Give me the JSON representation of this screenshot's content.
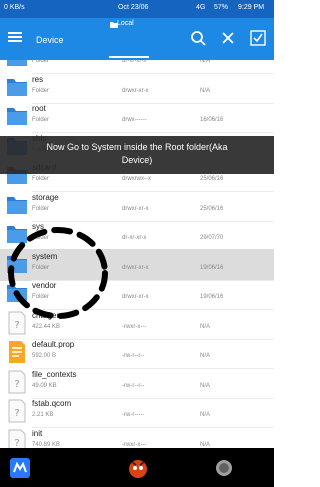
{
  "status_bar": {
    "time": "9:29 PM",
    "date": "Oct 23/06",
    "speed": "0 KB/s",
    "network": "4G",
    "battery": "57%"
  },
  "toolbar": {
    "title": "Device",
    "tab_label": "Local",
    "icons": [
      "menu-icon",
      "search-icon",
      "close-icon",
      "select-all-icon"
    ]
  },
  "files": [
    {
      "name": "proc",
      "type": "Folder",
      "perm": "dr-xr-xr-x",
      "date": "N/A",
      "icon": "folder"
    },
    {
      "name": "res",
      "type": "Folder",
      "perm": "drwxr-xr-x",
      "date": "N/A",
      "icon": "folder"
    },
    {
      "name": "root",
      "type": "Folder",
      "perm": "drwx------",
      "date": "16/06/16",
      "icon": "folder"
    },
    {
      "name": "sbin",
      "type": "Folder",
      "perm": "drwxr-x---",
      "date": "N/A",
      "icon": "folder"
    },
    {
      "name": "sdcard",
      "type": "Folder",
      "perm": "drwxrwx--x",
      "date": "25/06/16",
      "icon": "folder"
    },
    {
      "name": "storage",
      "type": "Folder",
      "perm": "drwxr-xr-x",
      "date": "25/06/16",
      "icon": "folder"
    },
    {
      "name": "sys",
      "type": "Folder",
      "perm": "dr-xr-xr-x",
      "date": "29/07/70",
      "icon": "folder"
    },
    {
      "name": "system",
      "type": "Folder",
      "perm": "drwxr-xr-x",
      "date": "19/06/16",
      "icon": "folder"
    },
    {
      "name": "vendor",
      "type": "Folder",
      "perm": "drwxr-xr-x",
      "date": "19/06/16",
      "icon": "folder"
    },
    {
      "name": "charger",
      "type": "422.44 KB",
      "perm": "-rwxr-x---",
      "date": "N/A",
      "icon": "unknown"
    },
    {
      "name": "default.prop",
      "type": "592.00 B",
      "perm": "-rw-r--r--",
      "date": "N/A",
      "icon": "text"
    },
    {
      "name": "file_contexts",
      "type": "49.09 KB",
      "perm": "-rw-r--r--",
      "date": "N/A",
      "icon": "unknown"
    },
    {
      "name": "fstab.qcom",
      "type": "2.21 KB",
      "perm": "-rw-r-----",
      "date": "N/A",
      "icon": "unknown"
    },
    {
      "name": "init",
      "type": "740.89 KB",
      "perm": "-rwxr-x---",
      "date": "N/A",
      "icon": "unknown"
    }
  ],
  "caption": {
    "line1": "Now Go to System inside the Root folder(Aka",
    "line2": "Device)"
  },
  "colors": {
    "status_bar": "#1565c0",
    "toolbar": "#1e88e5",
    "folder": "#2b7fd6",
    "highlight_row": "#dcdcdc",
    "annotation": "#000000"
  }
}
